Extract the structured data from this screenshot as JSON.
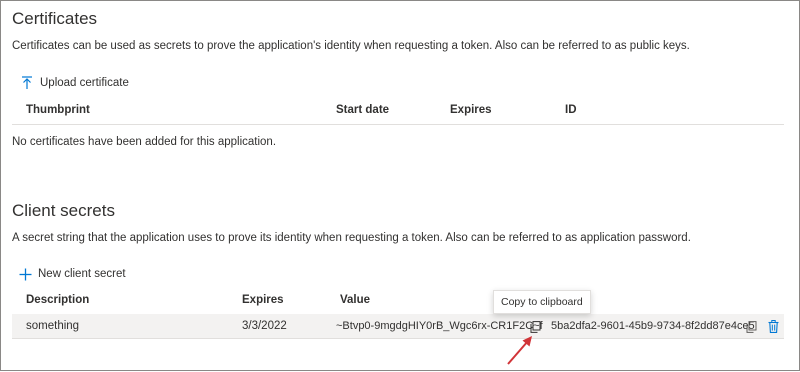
{
  "certificates": {
    "title": "Certificates",
    "description": "Certificates can be used as secrets to prove the application's identity when requesting a token. Also can be referred to as public keys.",
    "upload_label": "Upload certificate",
    "columns": [
      "Thumbprint",
      "Start date",
      "Expires",
      "ID"
    ],
    "empty_message": "No certificates have been added for this application."
  },
  "client_secrets": {
    "title": "Client secrets",
    "description": "A secret string that the application uses to prove its identity when requesting a token. Also can be referred to as application password.",
    "new_label": "New client secret",
    "columns": [
      "Description",
      "Expires",
      "Value"
    ],
    "rows": [
      {
        "description": "something",
        "expires": "3/3/2022",
        "value": "~Btvp0-9mgdgHIY0rB_Wgc6rx-CR1F2C~f",
        "id": "5ba2dfa2-9601-45b9-9734-8f2dd87e4ce5"
      }
    ]
  },
  "tooltip": {
    "text": "Copy to clipboard"
  },
  "colors": {
    "accent": "#0078d4",
    "annotation_arrow": "#d13438",
    "row_highlight": "#f3f2f1"
  },
  "icons": [
    "upload-icon",
    "add-icon",
    "copy-icon",
    "delete-icon"
  ]
}
